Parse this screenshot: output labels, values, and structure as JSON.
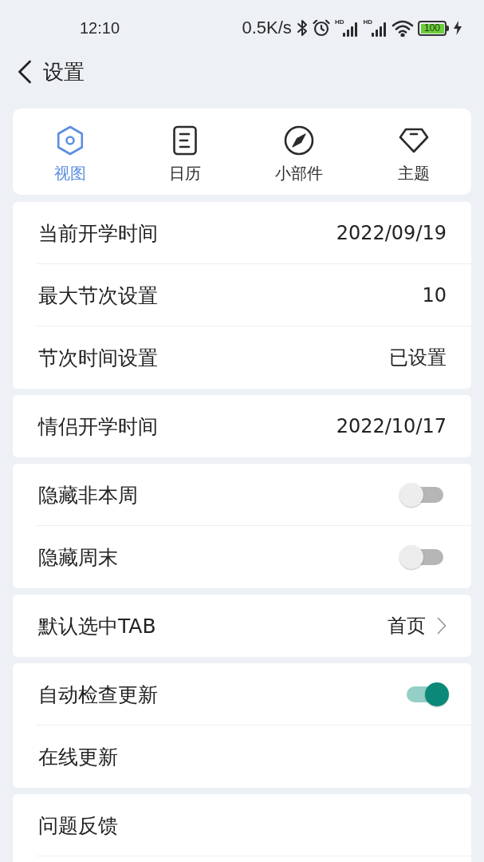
{
  "status_bar": {
    "time": "12:10",
    "net_speed": "0.5K/s",
    "signals": [
      {
        "badge": "HD"
      },
      {
        "badge": "HD"
      }
    ],
    "battery": {
      "text": "100",
      "charging": true
    }
  },
  "header": {
    "title": "设置"
  },
  "tabs": [
    {
      "kind": "view",
      "label": "视图",
      "selected": true
    },
    {
      "kind": "calendar",
      "label": "日历",
      "selected": false
    },
    {
      "kind": "widget",
      "label": "小部件",
      "selected": false
    },
    {
      "kind": "theme",
      "label": "主题",
      "selected": false
    }
  ],
  "groups": [
    {
      "rows": [
        {
          "kind": "value",
          "label": "当前开学时间",
          "value": "2022/09/19"
        },
        {
          "kind": "value",
          "label": "最大节次设置",
          "value": "10"
        },
        {
          "kind": "value",
          "label": "节次时间设置",
          "value": "已设置"
        }
      ]
    },
    {
      "rows": [
        {
          "kind": "value",
          "label": "情侣开学时间",
          "value": "2022/10/17"
        }
      ]
    },
    {
      "rows": [
        {
          "kind": "toggle",
          "label": "隐藏非本周",
          "on": false
        },
        {
          "kind": "toggle",
          "label": "隐藏周末",
          "on": false
        }
      ]
    },
    {
      "rows": [
        {
          "kind": "link",
          "label": "默认选中TAB",
          "value": "首页"
        }
      ]
    },
    {
      "rows": [
        {
          "kind": "toggle",
          "label": "自动检查更新",
          "on": true
        },
        {
          "kind": "plain",
          "label": "在线更新"
        }
      ]
    },
    {
      "rows": [
        {
          "kind": "plain",
          "label": "问题反馈"
        }
      ],
      "more_below": true
    }
  ]
}
